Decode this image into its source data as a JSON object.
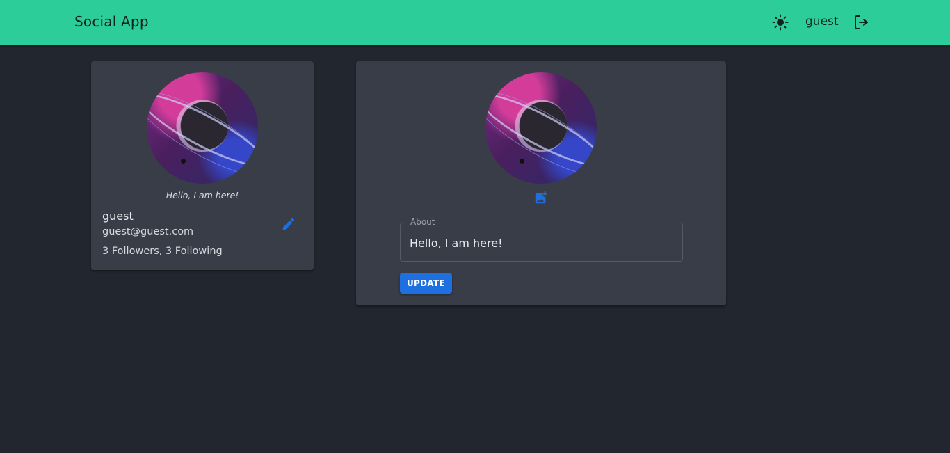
{
  "header": {
    "brand": "Social App",
    "username": "guest",
    "icons": {
      "theme": "sun-icon",
      "logout": "logout-icon"
    },
    "background_color": "#2dcd9a"
  },
  "profile": {
    "bio": "Hello, I am here!",
    "name": "guest",
    "email": "guest@guest.com",
    "follow_summary": "3 Followers, 3 Following",
    "edit_icon": "pencil-icon"
  },
  "edit_form": {
    "upload_icon": "add-photo-icon",
    "about_label": "About",
    "about_value": "Hello, I am here!",
    "update_label": "UPDATE"
  },
  "colors": {
    "page_background": "#22262e",
    "card_background": "#393d47",
    "accent": "#1e6fe0"
  }
}
